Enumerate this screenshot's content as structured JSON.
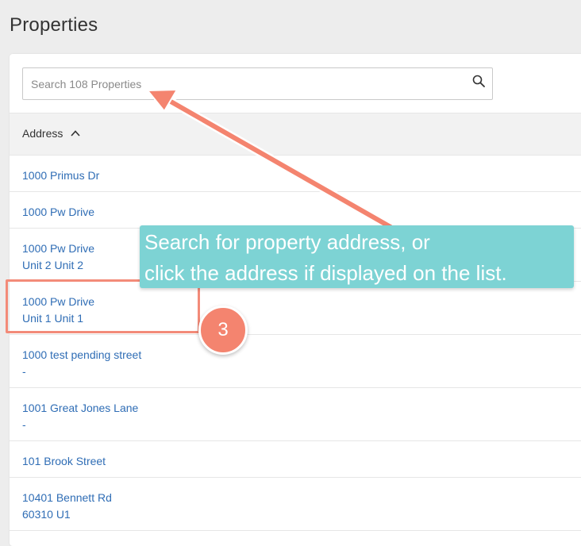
{
  "page": {
    "title": "Properties"
  },
  "search": {
    "placeholder": "Search 108 Properties",
    "value": ""
  },
  "table": {
    "columns": [
      {
        "label": "Address",
        "sort": "ascending"
      }
    ],
    "rows": [
      {
        "line1": "1000 Primus Dr",
        "line2": ""
      },
      {
        "line1": "1000 Pw Drive",
        "line2": ""
      },
      {
        "line1": "1000 Pw Drive",
        "line2": "Unit 2 Unit 2"
      },
      {
        "line1": "1000 Pw Drive",
        "line2": "Unit 1 Unit 1"
      },
      {
        "line1": "1000 test pending street",
        "line2": "-"
      },
      {
        "line1": "1001 Great Jones Lane",
        "line2": "-"
      },
      {
        "line1": "101 Brook Street",
        "line2": ""
      },
      {
        "line1": "10401 Bennett Rd",
        "line2": "60310 U1"
      }
    ]
  },
  "annotation": {
    "callout_line1": "Search for property address, or",
    "callout_line2": "click the address if displayed on the list.",
    "step_number": "3"
  },
  "colors": {
    "link": "#2f6db5",
    "callout": "#7dd3d4",
    "accent": "#f4846f"
  },
  "icons": {
    "search": "search-icon",
    "sort": "chevron-up-icon"
  }
}
